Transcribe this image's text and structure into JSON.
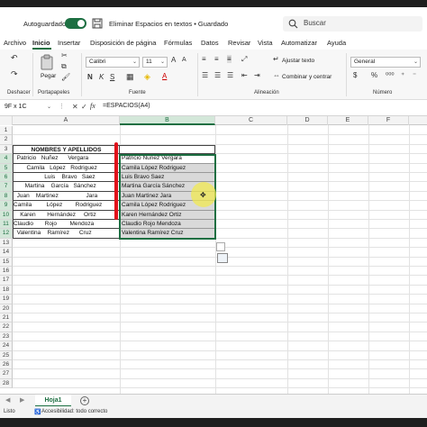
{
  "titlebar": {
    "autosave_label": "Autoguardado",
    "doc_title": "Eliminar Espacios en textos  •  Guardado",
    "search_placeholder": "Buscar"
  },
  "menu": {
    "tabs": [
      "Archivo",
      "Inicio",
      "Insertar",
      "Disposición de página",
      "Fórmulas",
      "Datos",
      "Revisar",
      "Vista",
      "Automatizar",
      "Ayuda"
    ],
    "active": "Inicio"
  },
  "ribbon": {
    "groups": {
      "undo": "Deshacer",
      "clipboard": "Portapapeles",
      "font": "Fuente",
      "alignment": "Alineación",
      "number": "Número"
    },
    "paste_label": "Pegar",
    "font_name": "Calibri",
    "font_size": "11",
    "wrap_text": "Ajustar texto",
    "merge_center": "Combinar y centrar",
    "number_format": "General"
  },
  "formula_bar": {
    "name_box": "9F x 1C",
    "formula": "=ESPACIOS(A4)"
  },
  "columns": [
    "A",
    "B",
    "C",
    "D",
    "E",
    "F"
  ],
  "rows": [
    "1",
    "2",
    "3",
    "4",
    "5",
    "6",
    "7",
    "8",
    "9",
    "10",
    "11",
    "12",
    "13",
    "14",
    "15",
    "16",
    "17",
    "18",
    "19",
    "20",
    "21",
    "22",
    "23",
    "24",
    "25",
    "26",
    "27",
    "28"
  ],
  "table": {
    "header": "NOMBRES Y APELLIDOS",
    "col_a": [
      "  Patricio   Nuñez      Vergara",
      "        Camila   López   Rodriguez",
      "                   Luis    Bravo   Saez",
      "       Martina    García   Sánchez",
      "  Juan    Martinez                 Jara",
      "Camila         López        Rodriguez",
      "    Karen       Hernández     Ortiz",
      "Claudio       Rojo        Mendoza",
      "  Valentina    Ramírez      Cruz"
    ],
    "col_b": [
      "Patricio Nuñez Vergara",
      "Camila López Rodriguez",
      "Luis Bravo Saez",
      "Martina García Sánchez",
      "Juan Martinez Jara",
      "Camila López Rodriguez",
      "Karen Hernández Ortiz",
      "Claudio Rojo Mendoza",
      "Valentina Ramírez Cruz"
    ]
  },
  "sheet": {
    "active_tab": "Hoja1"
  },
  "status": {
    "ready": "Listo",
    "accessibility": "Accesibilidad: todo correcto"
  },
  "colors": {
    "accent": "#1d6f42",
    "highlight_red": "#e0101a",
    "cursor_halo": "#f0e850"
  }
}
